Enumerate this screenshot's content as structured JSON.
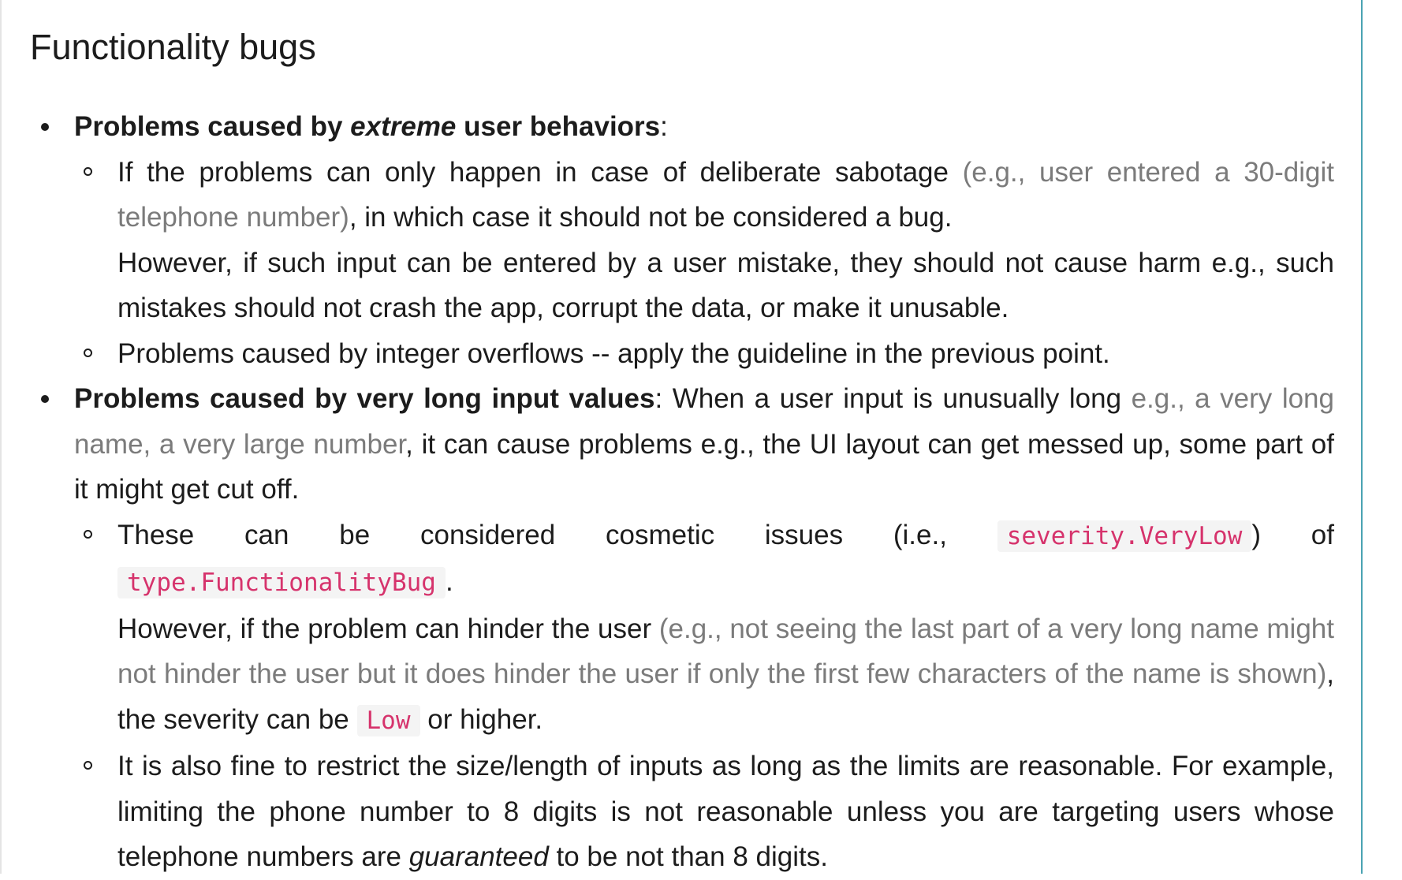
{
  "heading": "Functionality bugs",
  "items": [
    {
      "lead_a": "Problems caused by ",
      "lead_em": "extreme",
      "lead_b": " user behaviors",
      "lead_tail": ":",
      "subitems": [
        {
          "text_a": "If the problems can only happen in case of deliberate sabotage ",
          "muted": "(e.g., user entered a 30-digit telephone number)",
          "text_b": ", in which case it should not be considered a bug.",
          "para2": "However, if such input can be entered by a user mistake, they should not cause harm e.g., such mistakes should not crash the app, corrupt the data, or make it unusable."
        },
        {
          "text": "Problems caused by integer overflows -- apply the guideline in the previous point."
        }
      ]
    },
    {
      "lead": "Problems caused by very long input values",
      "text_a": ": When a user input is unusually long ",
      "muted": "e.g., a very long name, a very large number",
      "text_b": ", it can cause problems e.g., the UI layout can get messed up, some part of it might get cut off.",
      "subitems": [
        {
          "text_a": "These can be considered cosmetic issues (i.e., ",
          "code1": "severity.VeryLow",
          "text_b": ") of ",
          "code2": "type.FunctionalityBug",
          "text_c": ".",
          "para2_a": "However, if the problem can hinder the user ",
          "para2_muted": "(e.g., not seeing the last part of a very long name might not hinder the user but it does hinder the user if only the first few characters of the name is shown)",
          "para2_b": ", the severity can be ",
          "code3": "Low",
          "para2_c": " or higher."
        },
        {
          "text_a": "It is also fine to restrict the size/length of inputs as long as the limits are reasonable. For example, limiting the phone number to 8 digits is not reasonable unless you are targeting users whose telephone numbers are ",
          "em": "guaranteed",
          "text_b": " to be not than 8 digits."
        }
      ]
    }
  ]
}
